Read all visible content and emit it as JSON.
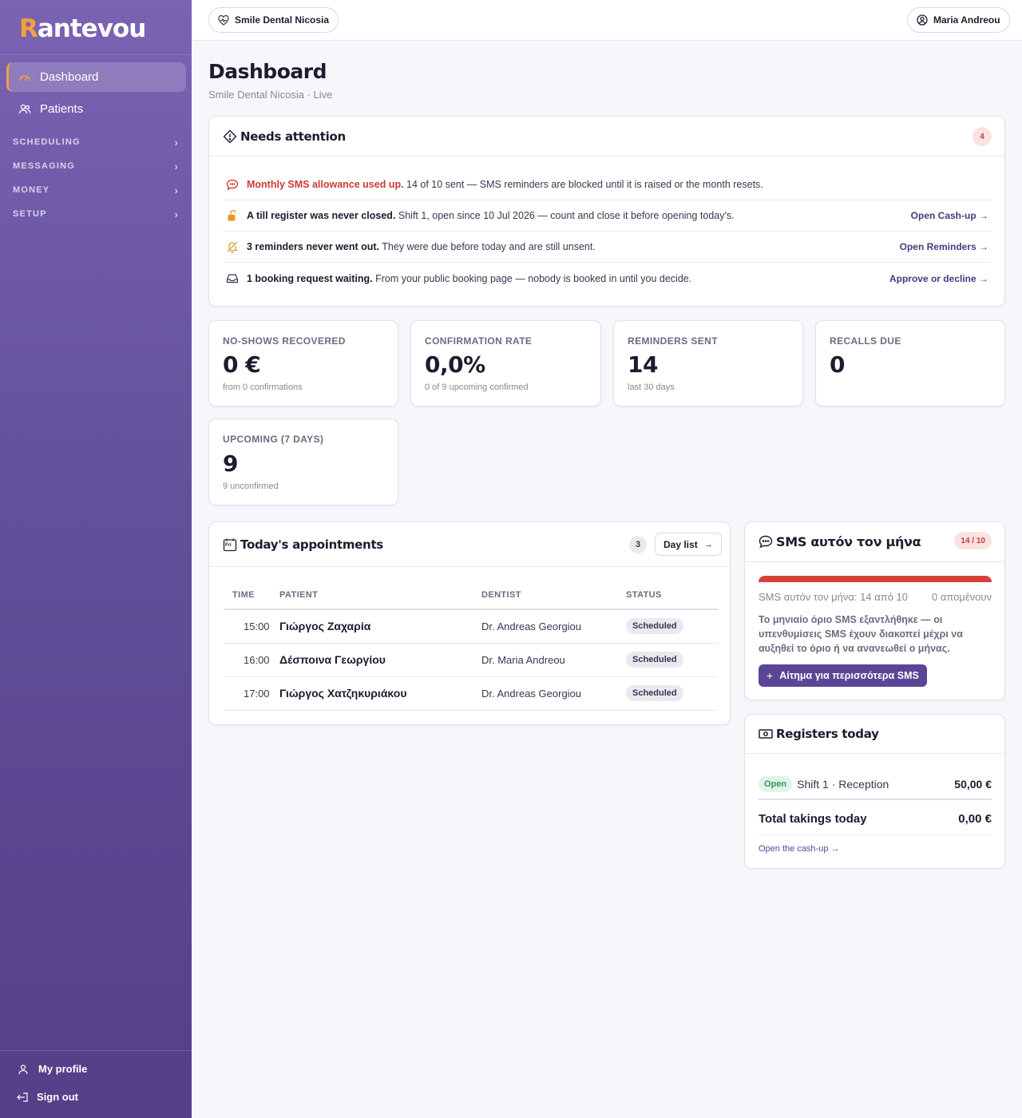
{
  "brand": {
    "logo_r": "R",
    "logo_rest": "antevou"
  },
  "sidebar": {
    "items": [
      {
        "label": "Dashboard",
        "icon": "gauge-icon"
      },
      {
        "label": "Patients",
        "icon": "users-icon"
      }
    ],
    "sections": [
      "SCHEDULING",
      "MESSAGING",
      "MONEY",
      "SETUP"
    ],
    "bottom": [
      {
        "label": "My profile",
        "icon": "user-icon"
      },
      {
        "label": "Sign out",
        "icon": "sign-out-icon"
      }
    ]
  },
  "topbar": {
    "clinic": "Smile Dental Nicosia",
    "user": "Maria Andreou"
  },
  "header": {
    "title": "Dashboard",
    "subtitle": "Smile Dental Nicosia · Live"
  },
  "attention": {
    "title": "Needs attention",
    "count": "4",
    "rows": [
      {
        "bold": "Monthly SMS allowance used up.",
        "text": " 14 of 10 sent — SMS reminders are blocked until it is raised or the month resets.",
        "link": ""
      },
      {
        "bold": "A till register was never closed.",
        "text": " Shift 1, open since 10 Jul 2026 — count and close it before opening today's.",
        "link": "Open Cash-up →"
      },
      {
        "bold": "3 reminders never went out.",
        "text": " They were due before today and are still unsent.",
        "link": "Open Reminders →"
      },
      {
        "bold": "1 booking request waiting.",
        "text": " From your public booking page — nobody is booked in until you decide.",
        "link": "Approve or decline →"
      }
    ]
  },
  "kpis": [
    {
      "label": "NO-SHOWS RECOVERED",
      "value": "0 €",
      "sub": "from 0 confirmations"
    },
    {
      "label": "CONFIRMATION RATE",
      "value": "0,0%",
      "sub": "0 of 9 upcoming confirmed"
    },
    {
      "label": "REMINDERS SENT",
      "value": "14",
      "sub": "last 30 days"
    },
    {
      "label": "RECALLS DUE",
      "value": "0",
      "sub": ""
    },
    {
      "label": "UPCOMING (7 DAYS)",
      "value": "9",
      "sub": "9 unconfirmed"
    }
  ],
  "appointments": {
    "title": "Today's appointments",
    "calendar_day": "Fri",
    "count": "3",
    "day_list": "Day list",
    "columns": [
      "TIME",
      "PATIENT",
      "DENTIST",
      "STATUS"
    ],
    "rows": [
      {
        "time": "15:00",
        "patient": "Γιώργος Ζαχαρία",
        "dentist": "Dr. Andreas Georgiou",
        "status": "Scheduled"
      },
      {
        "time": "16:00",
        "patient": "Δέσποινα Γεωργίου",
        "dentist": "Dr. Maria Andreou",
        "status": "Scheduled"
      },
      {
        "time": "17:00",
        "patient": "Γιώργος Χατζηκυριάκου",
        "dentist": "Dr. Andreas Georgiou",
        "status": "Scheduled"
      }
    ]
  },
  "sms": {
    "title": "SMS αυτόν τον μήνα",
    "badge": "14 / 10",
    "usage_fraction": 1.0,
    "usage_text": "SMS αυτόν τον μήνα: 14 από 10",
    "remaining": "0 απομένουν",
    "warning": "Το μηνιαίο όριο SMS εξαντλήθηκε — οι υπενθυμίσεις SMS έχουν διακοπεί μέχρι να αυξηθεί το όριο ή να ανανεωθεί ο μήνας.",
    "button": "Αίτημα για περισσότερα SMS"
  },
  "registers": {
    "title": "Registers today",
    "row_status": "Open",
    "row_label": "Shift 1 · Reception",
    "row_amount": "50,00 €",
    "total_label": "Total takings today",
    "total_amount": "0,00 €",
    "link": "Open the cash-up →"
  },
  "colors": {
    "accent": "#5b4596",
    "brand_orange": "#f2a23c",
    "danger": "#cc3b34",
    "open_green": "#2e9b55"
  }
}
